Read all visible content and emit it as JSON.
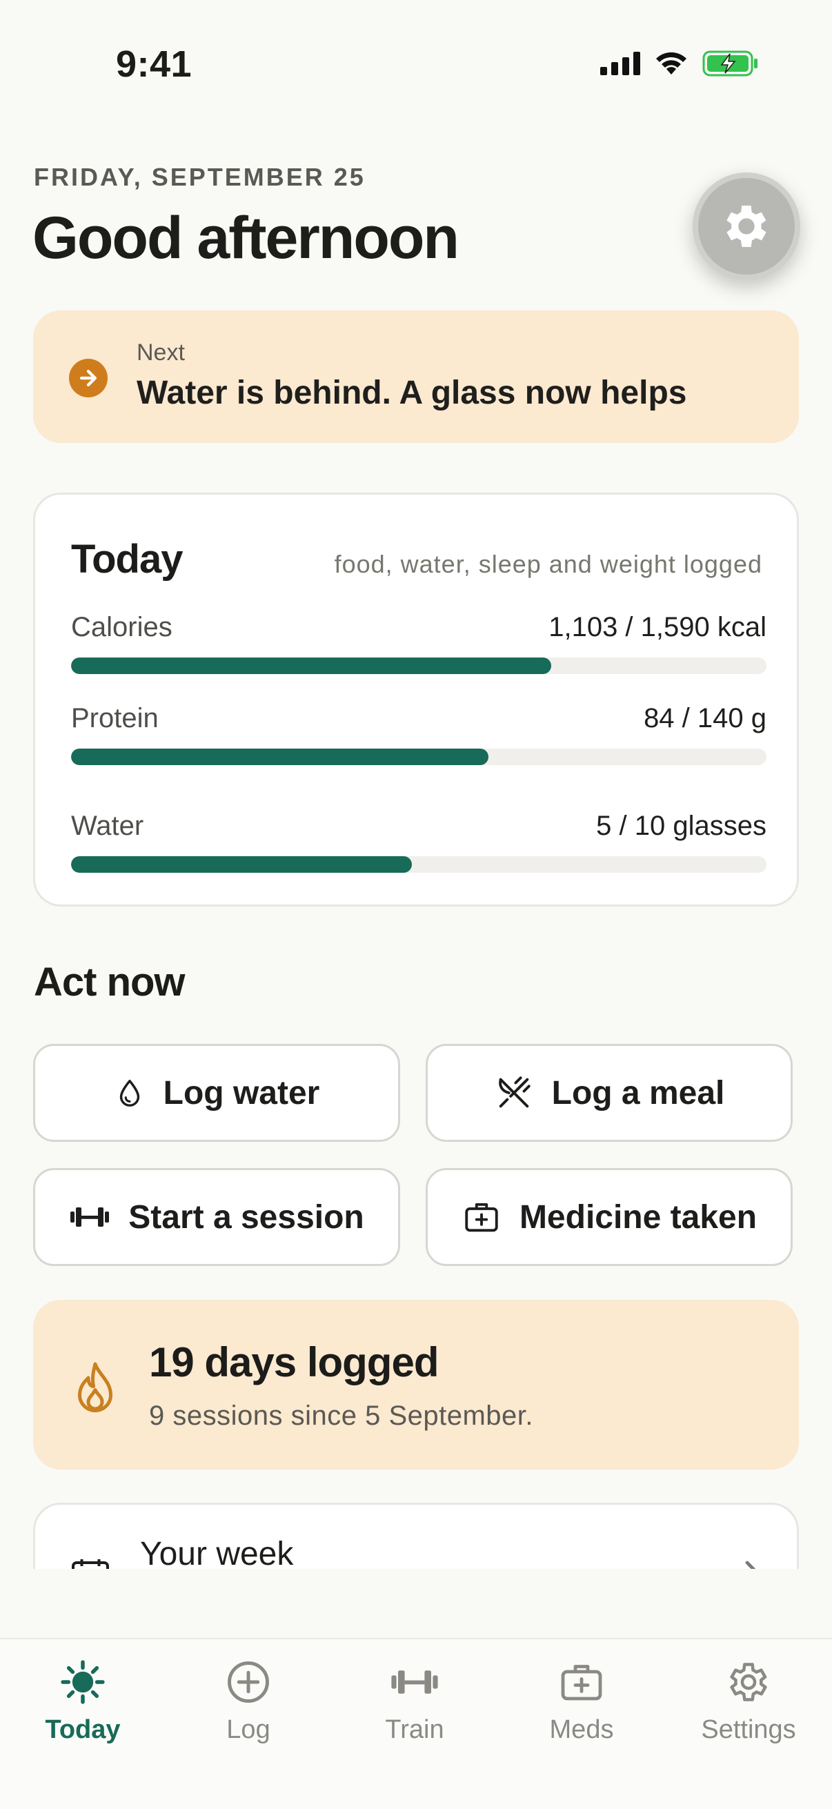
{
  "status_bar": {
    "time": "9:41"
  },
  "header": {
    "date": "FRIDAY, SEPTEMBER 25",
    "greeting": "Good afternoon",
    "settings_icon": "gear-icon"
  },
  "next_banner": {
    "label": "Next",
    "text": "Water is behind. A glass now helps",
    "icon": "arrow-right-icon"
  },
  "today": {
    "title": "Today",
    "subtitle": "food, water, sleep and weight logged",
    "metrics": [
      {
        "label": "Calories",
        "value": "1,103 / 1,590 kcal",
        "progress": 0.69
      },
      {
        "label": "Protein",
        "value": "84 / 140 g",
        "progress": 0.6
      },
      {
        "label": "Water",
        "value": "5 / 10 glasses",
        "progress": 0.49
      }
    ]
  },
  "act_now": {
    "title": "Act now",
    "actions": [
      {
        "label": "Log water",
        "icon": "droplet-icon"
      },
      {
        "label": "Log a meal",
        "icon": "utensils-icon"
      },
      {
        "label": "Start a session",
        "icon": "dumbbell-icon"
      },
      {
        "label": "Medicine taken",
        "icon": "medkit-icon"
      }
    ]
  },
  "streak": {
    "title": "19 days logged",
    "subtitle": "9 sessions since 5 September.",
    "icon": "flame-icon"
  },
  "week": {
    "title": "Your week",
    "icon": "calendar-icon"
  },
  "tabs": [
    {
      "label": "Today",
      "icon": "sun-icon",
      "active": true
    },
    {
      "label": "Log",
      "icon": "plus-circle-icon"
    },
    {
      "label": "Train",
      "icon": "dumbbell-icon"
    },
    {
      "label": "Meds",
      "icon": "medkit-icon"
    },
    {
      "label": "Settings",
      "icon": "gear-icon"
    }
  ],
  "colors": {
    "accent": "#176b58",
    "warm_banner": "#fbe9d0",
    "warm_icon": "#cf7d1c",
    "battery_green": "#33c24d"
  }
}
